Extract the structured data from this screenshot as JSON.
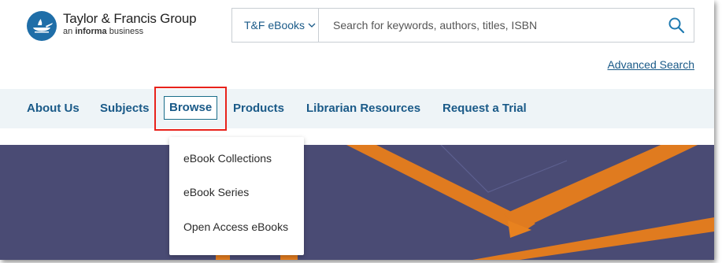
{
  "header": {
    "brand_name": "Taylor & Francis Group",
    "brand_sub_prefix": "an",
    "brand_sub_bold": "informa",
    "brand_sub_suffix": "business",
    "logo_icon": "taylor-francis-lamp-icon"
  },
  "search": {
    "scope_label": "T&F eBooks",
    "placeholder": "Search for keywords, authors, titles, ISBN",
    "value": "",
    "button_icon": "search-icon"
  },
  "advanced_search": "Advanced Search",
  "nav": {
    "items": [
      {
        "label": "About Us"
      },
      {
        "label": "Subjects"
      },
      {
        "label": "Browse"
      },
      {
        "label": "Products"
      },
      {
        "label": "Librarian Resources"
      },
      {
        "label": "Request a Trial"
      }
    ]
  },
  "browse_menu": {
    "items": [
      {
        "label": "eBook Collections"
      },
      {
        "label": "eBook Series"
      },
      {
        "label": "Open Access eBooks"
      }
    ]
  },
  "colors": {
    "link": "#1a5a88",
    "nav_bg": "#eef4f7",
    "hero_bg": "#4a4b74",
    "hero_accent": "#e07b1f",
    "highlight": "#e8221b",
    "logo_blue": "#1f6ea8"
  }
}
